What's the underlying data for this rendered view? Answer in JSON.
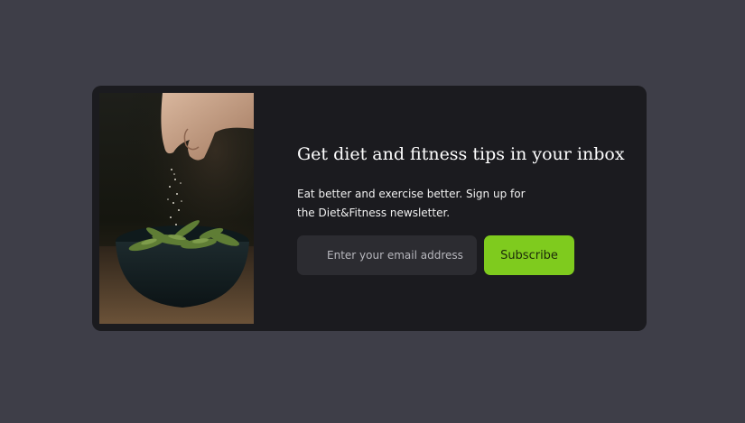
{
  "newsletter": {
    "title": "Get diet and fitness tips in your inbox",
    "description": "Eat better and exercise better. Sign up for the Diet&Fitness newsletter.",
    "email_placeholder": "Enter your email address",
    "email_value": "",
    "subscribe_label": "Subscribe"
  },
  "colors": {
    "page_background": "#3e3e48",
    "card_background": "#1b1b1f",
    "input_background": "#2c2c31",
    "accent": "#7fcb1e"
  },
  "image": {
    "subject": "hand sprinkling salt onto a bowl of edamame"
  }
}
